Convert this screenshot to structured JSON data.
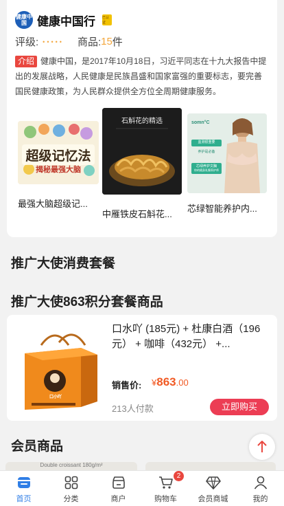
{
  "store": {
    "logo_text": "健康中国",
    "name": "健康中国行",
    "cert_badge": "已认证",
    "rating_label": "评级:",
    "stars": "•••••",
    "goods_label": "商品:",
    "goods_count": "15",
    "goods_unit": "件",
    "intro_tag": "介绍",
    "intro_text": "健康中国，是2017年10月18日，习近平同志在十九大报告中提出的发展战略，人民健康是民族昌盛和国家富强的重要标志，要完善国民健康政策，为人民群众提供全方位全周期健康服务。"
  },
  "featured_products": [
    {
      "name": "最强大脑超级记...",
      "img_title": "超级记忆法",
      "img_sub": "揭秘最强大脑"
    },
    {
      "name": "中雁铁皮石斛花...",
      "img_title": "石斛花的精选"
    },
    {
      "name": "芯绿智能养护内...",
      "img_brand": "somn°C",
      "img_line1": "监测很重要",
      "img_line2": "养护是必备",
      "img_line3": "芯绿养护文胸",
      "img_line4": "你的随身乳腺养护师"
    }
  ],
  "sections": {
    "consumption_package": "推广大使消费套餐",
    "points_package": "推广大使863积分套餐商品",
    "member_goods": "会员商品"
  },
  "package_item": {
    "name": "口水吖 (185元) + 杜康白酒（196元） + 咖啡（432元） +...",
    "price_label": "销售价:",
    "price_symbol": "¥",
    "price_int": "863",
    "price_dec": ".00",
    "sold": "213人付款",
    "buy_label": "立即购买",
    "box_text": "口小吖"
  },
  "member_strip": {
    "tile_text": "Double croissant 180g/m²"
  },
  "tabbar": [
    {
      "label": "首页",
      "icon": "home-icon",
      "active": true
    },
    {
      "label": "分类",
      "icon": "grid-icon"
    },
    {
      "label": "商户",
      "icon": "shop-icon"
    },
    {
      "label": "购物车",
      "icon": "cart-icon",
      "badge": "2"
    },
    {
      "label": "会员商城",
      "icon": "diamond-icon"
    },
    {
      "label": "我的",
      "icon": "user-icon"
    }
  ],
  "colors": {
    "accent": "#2f7ee6",
    "price": "#f15a24",
    "buy": "#ec3d54",
    "tag": "#e9473f"
  }
}
